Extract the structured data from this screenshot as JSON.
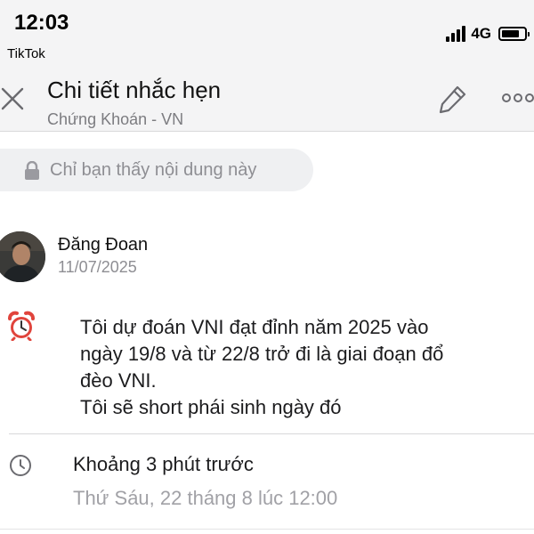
{
  "status_bar": {
    "time": "12:03",
    "back_app": "TikTok",
    "network": "4G",
    "battery_level": 0.8,
    "signal_bars": 4
  },
  "header": {
    "title": "Chi tiết nhắc hẹn",
    "subtitle": "Chứng Khoán - VN",
    "close_icon": "close-icon",
    "edit_icon": "pencil-icon",
    "more_icon": "more-icon"
  },
  "privacy": {
    "icon": "lock-icon",
    "text": "Chỉ bạn thấy nội dung này"
  },
  "author": {
    "name": "Đăng Đoan",
    "date": "11/07/2025"
  },
  "reminder": {
    "icon": "alarm-clock-icon",
    "lines": [
      "Tôi dự đoán VNI đạt đỉnh năm 2025 vào",
      "ngày 19/8 và từ 22/8 trở đi là giai đoạn đổ",
      "đèo VNI.",
      "Tôi sẽ short phái sinh ngày đó"
    ]
  },
  "schedule": {
    "icon": "clock-icon",
    "relative": "Khoảng 3 phút trước",
    "absolute": "Thứ Sáu, 22 tháng 8 lúc 12:00"
  },
  "colors": {
    "header_bg": "#f4f4f5",
    "pill_bg": "#eff0f2",
    "muted_text": "#8e8e93",
    "alarm_red": "#e0443c"
  }
}
